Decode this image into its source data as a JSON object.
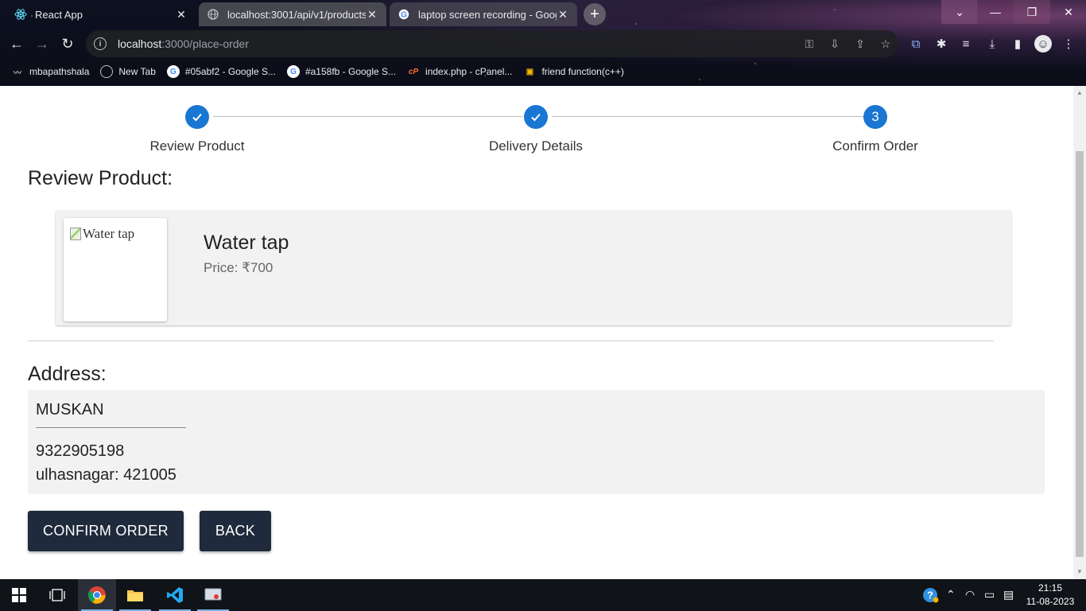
{
  "browser": {
    "tabs": [
      {
        "title": "React App",
        "active": true
      },
      {
        "title": "localhost:3001/api/v1/products",
        "active": false
      },
      {
        "title": "laptop screen recording - Google",
        "active": false
      }
    ],
    "address_bar": {
      "host": "localhost",
      "path": ":3000/place-order"
    },
    "bookmarks": [
      {
        "label": "mbapathshala",
        "icon": "wave-icon"
      },
      {
        "label": "New Tab",
        "icon": "globe-icon"
      },
      {
        "label": "#05abf2 - Google S...",
        "icon": "google-icon"
      },
      {
        "label": "#a158fb - Google S...",
        "icon": "google-icon"
      },
      {
        "label": "index.php - cPanel...",
        "icon": "cpanel-icon"
      },
      {
        "label": "friend function(c++)",
        "icon": "bookmark-icon"
      }
    ]
  },
  "stepper": {
    "steps": [
      {
        "label": "Review Product",
        "state": "completed"
      },
      {
        "label": "Delivery Details",
        "state": "completed"
      },
      {
        "label": "Confirm Order",
        "state": "active",
        "number": "3"
      }
    ]
  },
  "review": {
    "heading": "Review Product:",
    "product": {
      "image_alt": "Water tap",
      "name": "Water tap",
      "price": "Price: ₹700"
    }
  },
  "address": {
    "heading": "Address:",
    "name": "MUSKAN",
    "phone": "9322905198",
    "city_line": "ulhasnagar: 421005"
  },
  "actions": {
    "confirm_label": "CONFIRM ORDER",
    "back_label": "BACK"
  },
  "taskbar": {
    "time": "21:15",
    "date": "11-08-2023"
  },
  "colors": {
    "step_blue": "#1976d2",
    "button_dark": "#1f2a3c",
    "card_bg": "#f2f2f2"
  }
}
